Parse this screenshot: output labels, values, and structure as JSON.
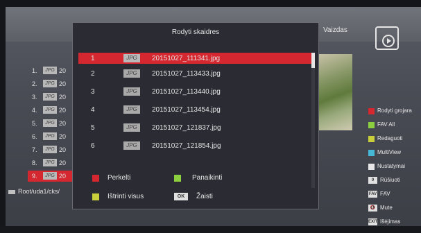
{
  "header": {
    "section_title": "Vaizdas",
    "section_icon": "media-player-icon"
  },
  "background_list": {
    "items": [
      {
        "num": "1.",
        "type": "JPG",
        "name": "20"
      },
      {
        "num": "2.",
        "type": "JPG",
        "name": "20"
      },
      {
        "num": "3.",
        "type": "JPG",
        "name": "20"
      },
      {
        "num": "4.",
        "type": "JPG",
        "name": "20"
      },
      {
        "num": "5.",
        "type": "JPG",
        "name": "20"
      },
      {
        "num": "6.",
        "type": "JPG",
        "name": "20"
      },
      {
        "num": "7.",
        "type": "JPG",
        "name": "20"
      },
      {
        "num": "8.",
        "type": "JPG",
        "name": "20"
      },
      {
        "num": "9.",
        "type": "JPG",
        "name": "20"
      }
    ],
    "selected_index": 8,
    "path": "Root/uda1/cks/"
  },
  "dialog": {
    "title": "Rodyti skaidres",
    "items": [
      {
        "num": "1",
        "type": "JPG",
        "file": "20151027_111341.jpg"
      },
      {
        "num": "2",
        "type": "JPG",
        "file": "20151027_113433.jpg"
      },
      {
        "num": "3",
        "type": "JPG",
        "file": "20151027_113440.jpg"
      },
      {
        "num": "4",
        "type": "JPG",
        "file": "20151027_113454.jpg"
      },
      {
        "num": "5",
        "type": "JPG",
        "file": "20151027_121837.jpg"
      },
      {
        "num": "6",
        "type": "JPG",
        "file": "20151027_121854.jpg"
      }
    ],
    "selected_index": 0,
    "actions": {
      "move": "Perkelti",
      "remove": "Panaikinti",
      "clear_all": "Ištrinti visus",
      "ok_key": "OK",
      "play": "Žaisti"
    }
  },
  "right_menu": {
    "items": [
      {
        "color": "#d4272f",
        "label": "Rodyti grojara"
      },
      {
        "color": "#8ccf3f",
        "label": "FAV All"
      },
      {
        "color": "#c9cf3a",
        "label": "Redaguoti"
      },
      {
        "color": "#47b7d6",
        "label": "MultiView"
      },
      {
        "color": "#e6e6e6",
        "label": "Nustatymai"
      },
      {
        "key": "0",
        "label": "Rūšiuoti"
      },
      {
        "key": "FAV",
        "label": "FAV"
      },
      {
        "key": "🔇",
        "label": "Mute"
      },
      {
        "key": "EXIT",
        "label": "Išėjimas"
      }
    ]
  },
  "colors": {
    "selection": "#d4272f",
    "green_key": "#8ccf3f",
    "yellow_key": "#c9cf3a"
  }
}
